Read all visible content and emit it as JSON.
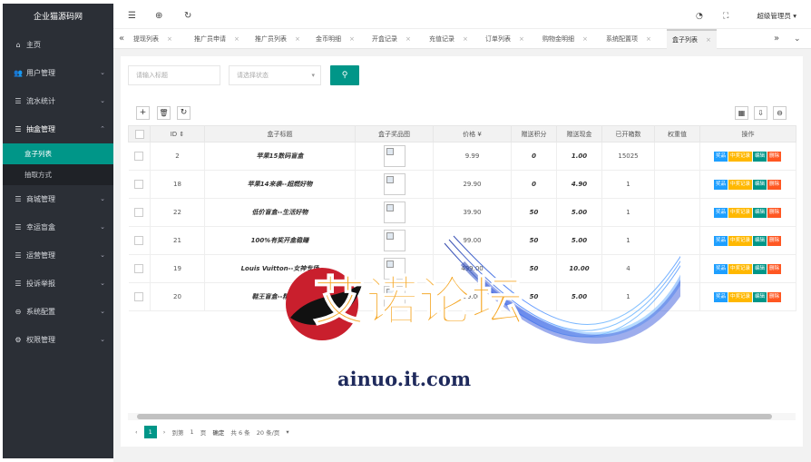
{
  "app": {
    "title": "企业猫源码网"
  },
  "sidebar": {
    "items": [
      {
        "icon": "home-icon",
        "glyph": "⌂",
        "label": "主页"
      },
      {
        "icon": "users-icon",
        "glyph": "👥",
        "label": "用户管理"
      },
      {
        "icon": "list-icon",
        "glyph": "☰",
        "label": "流水统计"
      },
      {
        "icon": "list-icon",
        "glyph": "☰",
        "label": "抽盒管理"
      }
    ],
    "sub_items": [
      {
        "label": "盒子列表",
        "active": true
      },
      {
        "label": "抽取方式",
        "active": false
      }
    ],
    "items_after": [
      {
        "icon": "list-icon",
        "glyph": "☰",
        "label": "商城管理"
      },
      {
        "icon": "list-icon",
        "glyph": "☰",
        "label": "幸运盲盒"
      },
      {
        "icon": "list-icon",
        "glyph": "☰",
        "label": "运营管理"
      },
      {
        "icon": "list-icon",
        "glyph": "☰",
        "label": "投诉举报"
      },
      {
        "icon": "settings-icon",
        "glyph": "⊖",
        "label": "系统配置"
      },
      {
        "icon": "gear-icon",
        "glyph": "⚙",
        "label": "权限管理"
      }
    ]
  },
  "header": {
    "admin_label": "超级管理员"
  },
  "tabs": [
    {
      "label": "提现列表"
    },
    {
      "label": "推广员申请"
    },
    {
      "label": "推广员列表"
    },
    {
      "label": "金币明细"
    },
    {
      "label": "开盒记录"
    },
    {
      "label": "充值记录"
    },
    {
      "label": "订单列表"
    },
    {
      "label": "购物金明细"
    },
    {
      "label": "系统配置项"
    },
    {
      "label": "盒子列表",
      "active": true
    }
  ],
  "search": {
    "title_placeholder": "请输入标题",
    "status_placeholder": "请选择状态"
  },
  "table": {
    "columns": [
      "ID",
      "盒子标题",
      "盒子奖品图",
      "价格 ¥",
      "赠送积分",
      "赠送现金",
      "已开箱数",
      "权重值",
      "操作"
    ],
    "rows": [
      {
        "id": "2",
        "title": "苹果15数码盲盒",
        "price": "9.99",
        "points": "0",
        "cash": "1.00",
        "opened": "15025"
      },
      {
        "id": "18",
        "title": "苹果14来袭--超燃好物",
        "price": "29.90",
        "points": "0",
        "cash": "4.90",
        "opened": "1"
      },
      {
        "id": "22",
        "title": "低价盲盒--生活好物",
        "price": "39.90",
        "points": "50",
        "cash": "5.00",
        "opened": "1"
      },
      {
        "id": "21",
        "title": "100%有奖开盒稳赚",
        "price": "99.00",
        "points": "50",
        "cash": "5.00",
        "opened": "1"
      },
      {
        "id": "19",
        "title": "Louis Vuitton--女神专场",
        "price": "499.00",
        "points": "50",
        "cash": "10.00",
        "opened": "4"
      },
      {
        "id": "20",
        "title": "鞋王盲盒--精物精选",
        "price": "99.00",
        "points": "50",
        "cash": "5.00",
        "opened": "1"
      }
    ],
    "actions": [
      {
        "label": "奖品",
        "color": "#1e9fff"
      },
      {
        "label": "中奖记录",
        "color": "#ffb800"
      },
      {
        "label": "编辑",
        "color": "#009688"
      },
      {
        "label": "删除",
        "color": "#ff5722"
      }
    ]
  },
  "pager": {
    "current": "1",
    "goto_label": "到第",
    "page_value": "1",
    "page_unit": "页",
    "confirm": "确定",
    "total": "共 6 条",
    "page_size": "20 条/页"
  },
  "watermark": {
    "text_cn": "艾诺论坛",
    "text_en": "ainuo.it.com"
  },
  "colors": {
    "sidebar": "#2b2f36",
    "accent": "#009688"
  }
}
